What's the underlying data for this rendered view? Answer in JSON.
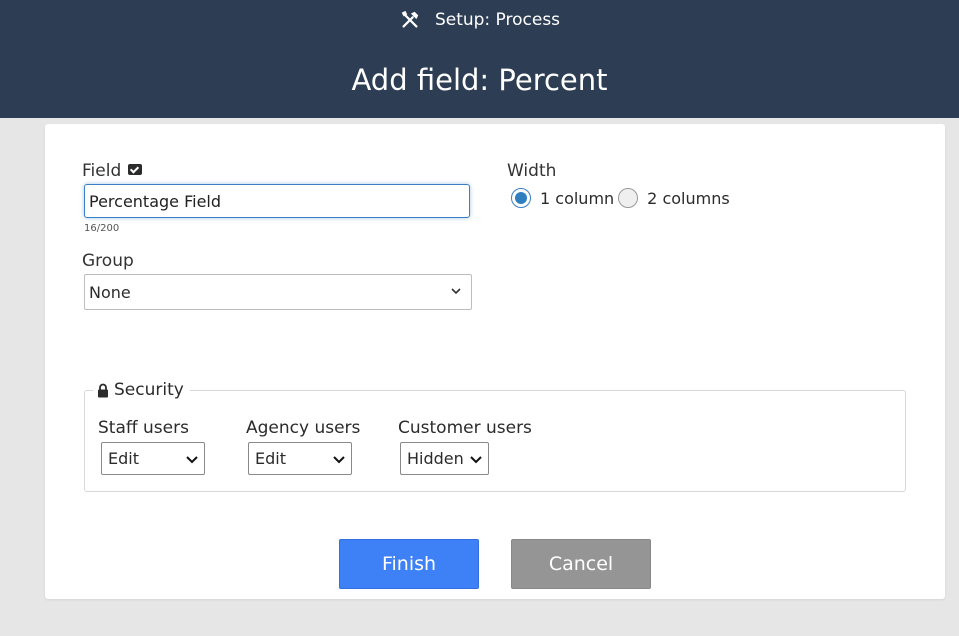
{
  "header": {
    "breadcrumb": "Setup: Process",
    "title": "Add field: Percent",
    "icon": "tools-icon"
  },
  "form": {
    "field": {
      "label": "Field",
      "value": "Percentage Field",
      "counter": "16/200"
    },
    "group": {
      "label": "Group",
      "selected": "None"
    },
    "width": {
      "label": "Width",
      "options": [
        {
          "label": "1 column",
          "checked": true
        },
        {
          "label": "2 columns",
          "checked": false
        }
      ]
    },
    "security": {
      "legend": "Security",
      "columns": [
        {
          "label": "Staff users",
          "selected": "Edit"
        },
        {
          "label": "Agency users",
          "selected": "Edit"
        },
        {
          "label": "Customer users",
          "selected": "Hidden"
        }
      ]
    }
  },
  "buttons": {
    "finish": "Finish",
    "cancel": "Cancel"
  },
  "colors": {
    "header_bg": "#2d3e54",
    "primary": "#3e80f5",
    "secondary": "#959595",
    "focus": "#3b7fc4"
  }
}
